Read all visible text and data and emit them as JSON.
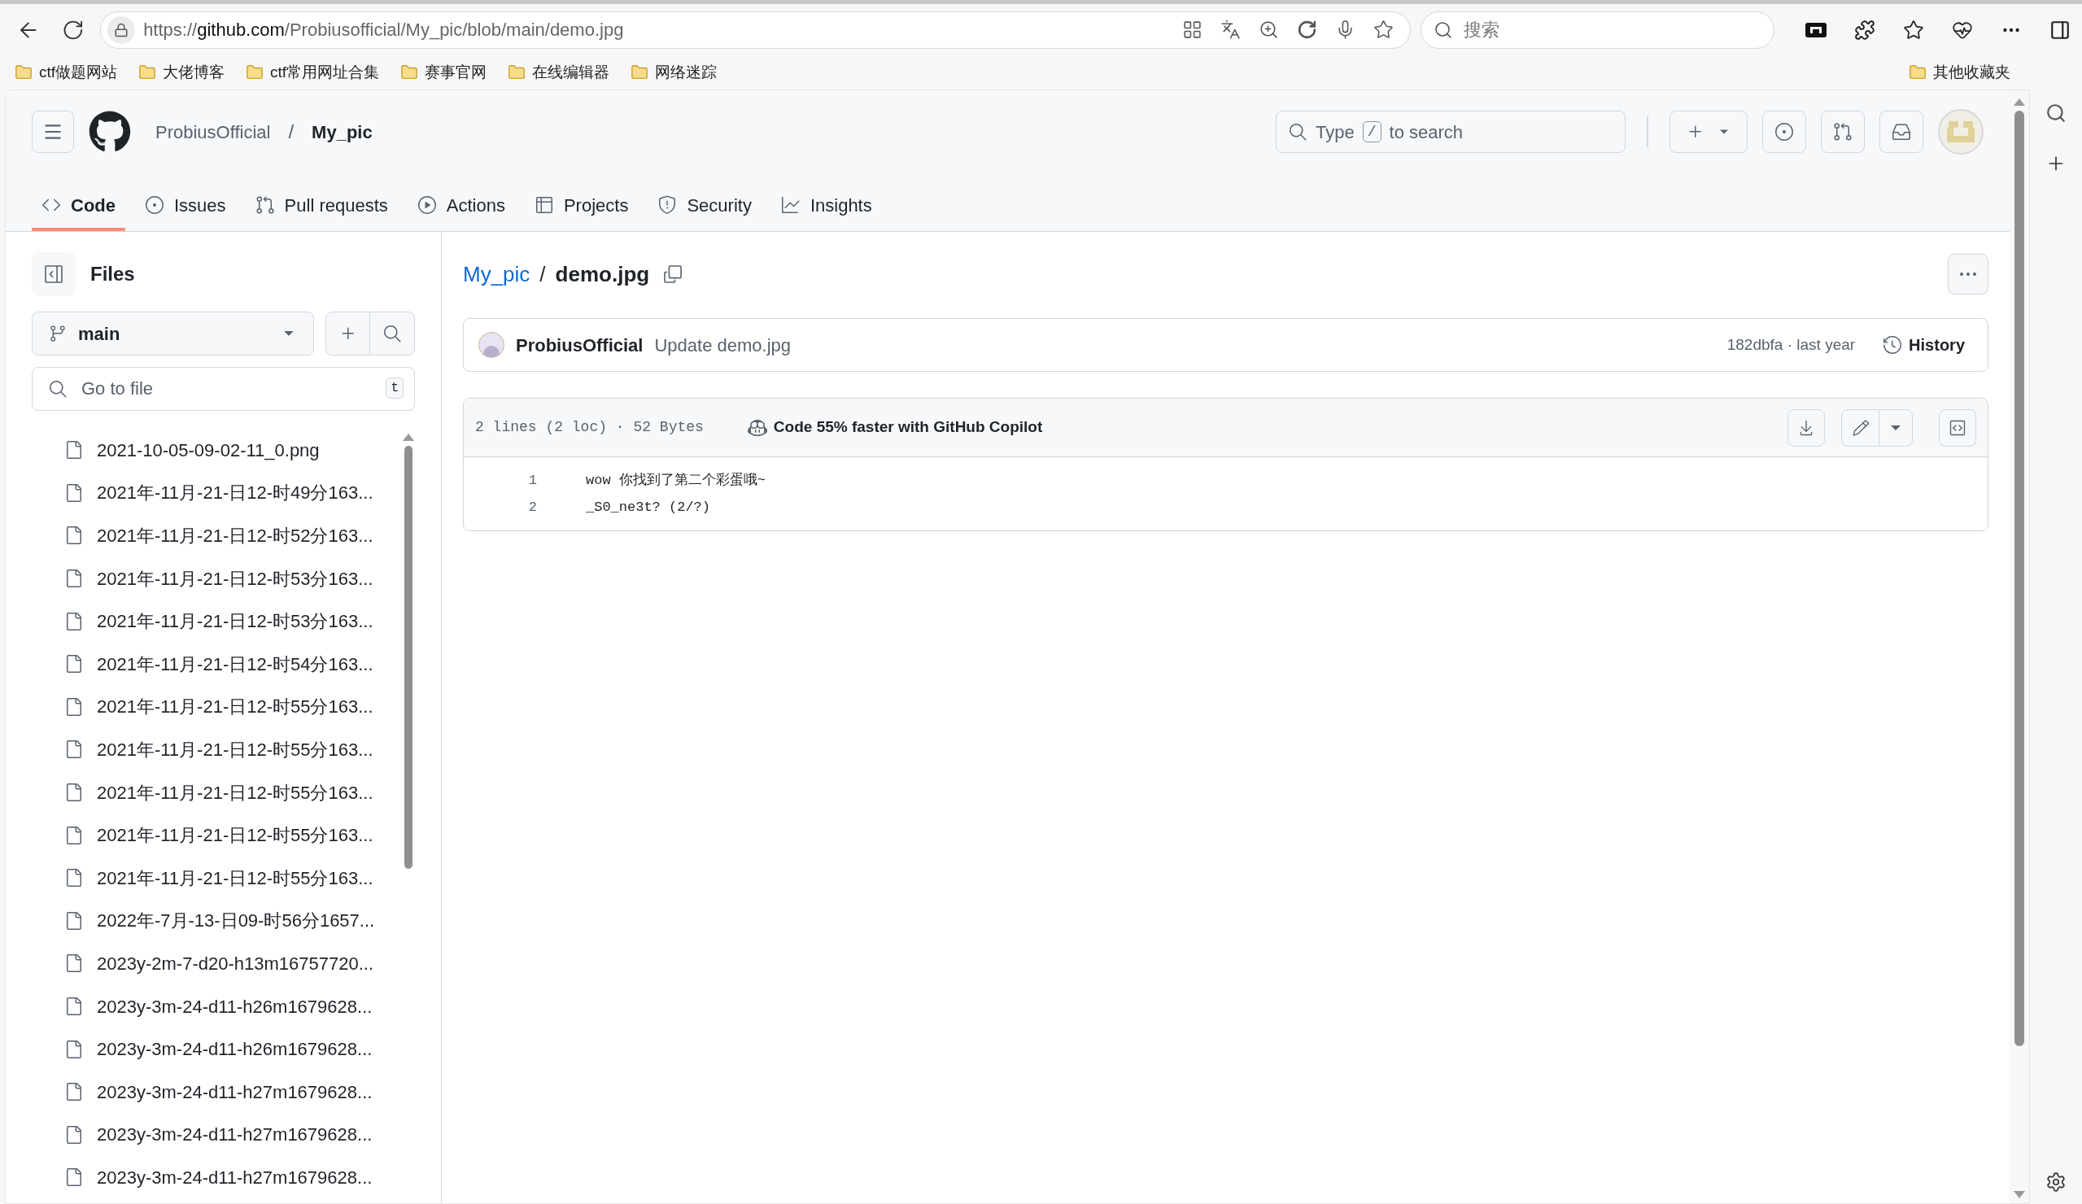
{
  "browser": {
    "url_scheme": "https://",
    "url_host": "github.com",
    "url_path": "/Probiusofficial/My_pic/blob/main/demo.jpg",
    "search_placeholder": "搜索",
    "bookmarks": [
      "ctf做题网站",
      "大佬博客",
      "ctf常用网址合集",
      "赛事官网",
      "在线编辑器",
      "网络迷踪"
    ],
    "other_bookmarks": "其他收藏夹"
  },
  "header": {
    "owner": "ProbiusOfficial",
    "separator": "/",
    "repo": "My_pic",
    "search": {
      "before": "Type",
      "key": "/",
      "after": "to search"
    }
  },
  "tabs": [
    {
      "label": "Code",
      "selected": true
    },
    {
      "label": "Issues",
      "selected": false
    },
    {
      "label": "Pull requests",
      "selected": false
    },
    {
      "label": "Actions",
      "selected": false
    },
    {
      "label": "Projects",
      "selected": false
    },
    {
      "label": "Security",
      "selected": false
    },
    {
      "label": "Insights",
      "selected": false
    }
  ],
  "sidebar": {
    "title": "Files",
    "branch": "main",
    "go_to_file": {
      "placeholder": "Go to file",
      "shortcut": "t"
    },
    "files": [
      "2021-10-05-09-02-11_0.png",
      "2021年-11月-21-日12-时49分163...",
      "2021年-11月-21-日12-时52分163...",
      "2021年-11月-21-日12-时53分163...",
      "2021年-11月-21-日12-时53分163...",
      "2021年-11月-21-日12-时54分163...",
      "2021年-11月-21-日12-时55分163...",
      "2021年-11月-21-日12-时55分163...",
      "2021年-11月-21-日12-时55分163...",
      "2021年-11月-21-日12-时55分163...",
      "2021年-11月-21-日12-时55分163...",
      "2022年-7月-13-日09-时56分1657...",
      "2023y-2m-7-d20-h13m16757720...",
      "2023y-3m-24-d11-h26m1679628...",
      "2023y-3m-24-d11-h26m1679628...",
      "2023y-3m-24-d11-h27m1679628...",
      "2023y-3m-24-d11-h27m1679628...",
      "2023y-3m-24-d11-h27m1679628..."
    ]
  },
  "file": {
    "breadcrumb_repo": "My_pic",
    "breadcrumb_separator": "/",
    "name": "demo.jpg",
    "commit": {
      "author": "ProbiusOfficial",
      "message": "Update demo.jpg",
      "meta": "182dbfa · last year",
      "history": "History"
    },
    "stats": "2 lines (2 loc) · 52 Bytes",
    "copilot": "Code 55% faster with GitHub Copilot",
    "lines": [
      {
        "number": "1",
        "text": "wow 你找到了第二个彩蛋哦~"
      },
      {
        "number": "2",
        "text": "_S0_ne3t? (2/?)"
      }
    ]
  }
}
